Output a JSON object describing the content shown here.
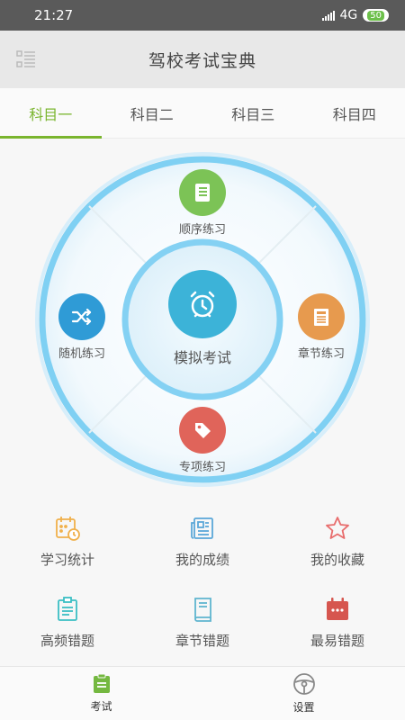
{
  "status": {
    "time": "21:27",
    "network": "4G",
    "battery": "50"
  },
  "header": {
    "title": "驾校考试宝典"
  },
  "tabs": [
    {
      "label": "科目一",
      "active": true
    },
    {
      "label": "科目二",
      "active": false
    },
    {
      "label": "科目三",
      "active": false
    },
    {
      "label": "科目四",
      "active": false
    }
  ],
  "wheel": {
    "center": {
      "label": "模拟考试",
      "icon": "alarm-clock-icon",
      "color": "#3cb3d8"
    },
    "top": {
      "label": "顺序练习",
      "icon": "notebook-icon",
      "color": "#7cc356"
    },
    "left": {
      "label": "随机练习",
      "icon": "shuffle-icon",
      "color": "#2f9bd6"
    },
    "right": {
      "label": "章节练习",
      "icon": "document-icon",
      "color": "#e79a4e"
    },
    "bottom": {
      "label": "专项练习",
      "icon": "tag-icon",
      "color": "#e0645a"
    }
  },
  "grid": [
    {
      "label": "学习统计",
      "icon": "calendar-clock-icon"
    },
    {
      "label": "我的成绩",
      "icon": "newspaper-icon"
    },
    {
      "label": "我的收藏",
      "icon": "star-icon"
    },
    {
      "label": "高频错题",
      "icon": "clipboard-icon"
    },
    {
      "label": "章节错题",
      "icon": "book-icon"
    },
    {
      "label": "最易错题",
      "icon": "calendar-icon"
    }
  ],
  "nav": [
    {
      "label": "考试",
      "icon": "exam-icon",
      "active": true
    },
    {
      "label": "设置",
      "icon": "steering-wheel-icon",
      "active": false
    }
  ]
}
